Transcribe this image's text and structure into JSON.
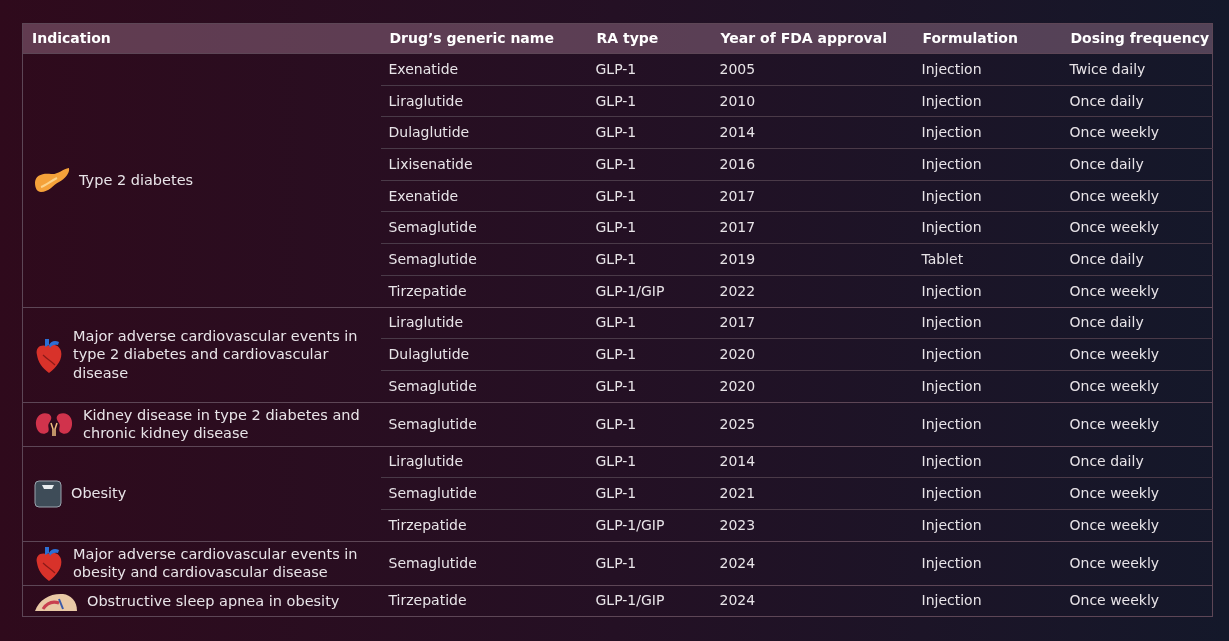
{
  "table": {
    "columns": [
      "Indication",
      "Drug’s generic name",
      "RA type",
      "Year of FDA approval",
      "Formulation",
      "Dosing frequency"
    ],
    "groups": [
      {
        "kind": "pancreas",
        "indication": "Type 2 diabetes",
        "rows": [
          [
            "Exenatide",
            "GLP-1",
            "2005",
            "Injection",
            "Twice daily"
          ],
          [
            "Liraglutide",
            "GLP-1",
            "2010",
            "Injection",
            "Once daily"
          ],
          [
            "Dulaglutide",
            "GLP-1",
            "2014",
            "Injection",
            "Once weekly"
          ],
          [
            "Lixisenatide",
            "GLP-1",
            "2016",
            "Injection",
            "Once daily"
          ],
          [
            "Exenatide",
            "GLP-1",
            "2017",
            "Injection",
            "Once weekly"
          ],
          [
            "Semaglutide",
            "GLP-1",
            "2017",
            "Injection",
            "Once weekly"
          ],
          [
            "Semaglutide",
            "GLP-1",
            "2019",
            "Tablet",
            "Once daily"
          ],
          [
            "Tirzepatide",
            "GLP-1/GIP",
            "2022",
            "Injection",
            "Once weekly"
          ]
        ]
      },
      {
        "kind": "heart",
        "indication": "Major adverse cardiovascular events in type 2 diabetes and cardiovascular disease",
        "rows": [
          [
            "Liraglutide",
            "GLP-1",
            "2017",
            "Injection",
            "Once daily"
          ],
          [
            "Dulaglutide",
            "GLP-1",
            "2020",
            "Injection",
            "Once weekly"
          ],
          [
            "Semaglutide",
            "GLP-1",
            "2020",
            "Injection",
            "Once weekly"
          ]
        ]
      },
      {
        "kind": "kidney",
        "indication": "Kidney disease in type 2 diabetes and chronic kidney disease",
        "rows": [
          [
            "Semaglutide",
            "GLP-1",
            "2025",
            "Injection",
            "Once weekly"
          ]
        ]
      },
      {
        "kind": "scale",
        "indication": "Obesity",
        "rows": [
          [
            "Liraglutide",
            "GLP-1",
            "2014",
            "Injection",
            "Once daily"
          ],
          [
            "Semaglutide",
            "GLP-1",
            "2021",
            "Injection",
            "Once weekly"
          ],
          [
            "Tirzepatide",
            "GLP-1/GIP",
            "2023",
            "Injection",
            "Once weekly"
          ]
        ]
      },
      {
        "kind": "heart",
        "indication": "Major adverse cardiovascular events in obesity and cardiovascular disease",
        "rows": [
          [
            "Semaglutide",
            "GLP-1",
            "2024",
            "Injection",
            "Once weekly"
          ]
        ]
      },
      {
        "kind": "sleep",
        "indication": "Obstructive sleep apnea in obesity",
        "rows": [
          [
            "Tirzepatide",
            "GLP-1/GIP",
            "2024",
            "Injection",
            "Once weekly"
          ]
        ]
      }
    ]
  }
}
